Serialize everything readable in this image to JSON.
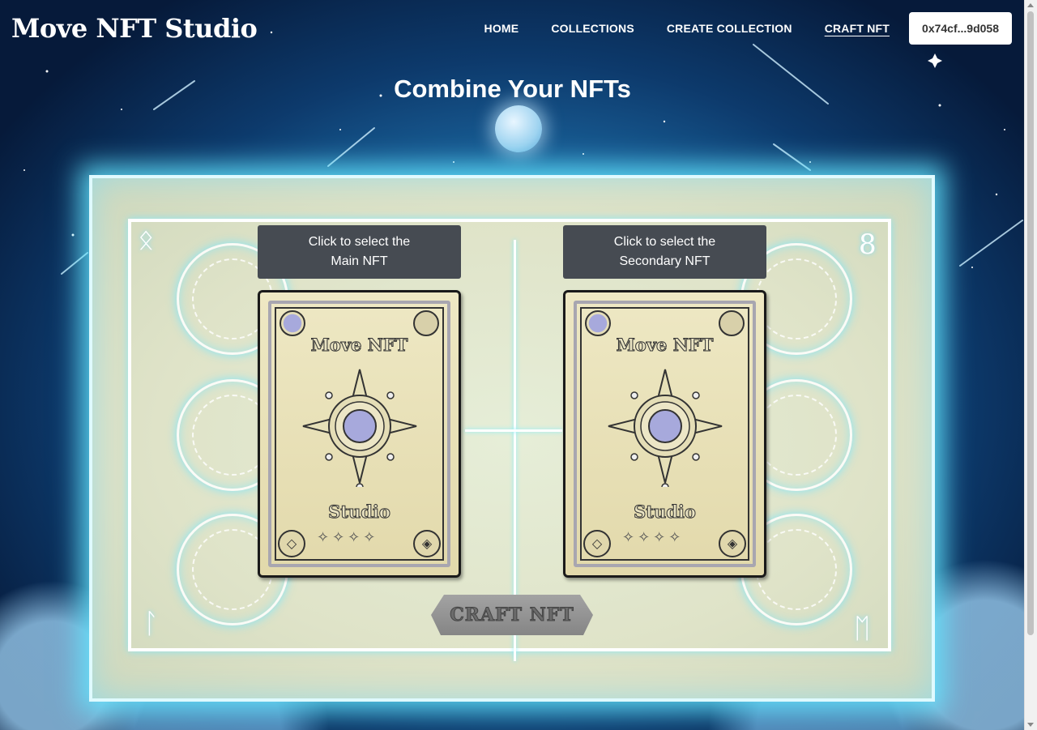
{
  "app": {
    "logo": "Move NFT Studio"
  },
  "nav": {
    "items": [
      {
        "label": "HOME"
      },
      {
        "label": "COLLECTIONS"
      },
      {
        "label": "CREATE COLLECTION"
      },
      {
        "label": "CRAFT NFT",
        "active": true
      }
    ],
    "wallet": "0x74cf...9d058"
  },
  "page": {
    "title": "Combine Your NFTs"
  },
  "slots": {
    "main": {
      "label_line1": "Click to select the",
      "label_line2": "Main NFT"
    },
    "secondary": {
      "label_line1": "Click to select the",
      "label_line2": "Secondary NFT"
    }
  },
  "card": {
    "title": "Move NFT",
    "subtitle": "Studio",
    "stars": "✧✧✧✧"
  },
  "board": {
    "glyphs": {
      "top_left": "ᛟ",
      "top_right": "8",
      "bottom_left": "ᛚ",
      "bottom_right": "ᛖ"
    }
  },
  "craft": {
    "label": "CRAFT NFT"
  },
  "colors": {
    "background_deep": "#061a3a",
    "glow": "#64e6ff",
    "slot_label_bg": "#464b52",
    "card_bg": "#eee8c4",
    "orb_blue": "#a7a9dc",
    "craft_button": "#959595"
  }
}
